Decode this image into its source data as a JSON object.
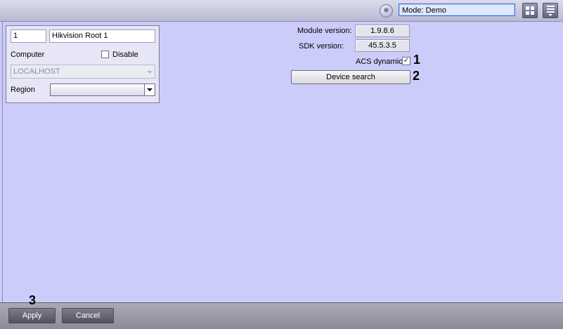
{
  "toolbar": {
    "mode_value": "Mode: Demo",
    "icons": [
      "star-icon",
      "grid-view-icon",
      "menu-icon"
    ]
  },
  "object_panel": {
    "id": "1",
    "name": "Hikvision Root 1",
    "computer_label": "Computer",
    "disable_label": "Disable",
    "disable_checked": false,
    "computer_value": "LOCALHOST",
    "region_label": "Region",
    "region_value": ""
  },
  "settings": {
    "module_version_label": "Module version:",
    "module_version_value": "1.9.8.6",
    "sdk_version_label": "SDK version:",
    "sdk_version_value": "45.5.3.5",
    "acs_dynamic_label": "ACS dynamic",
    "acs_dynamic_checked": true,
    "device_search_label": "Device search"
  },
  "callouts": [
    "1",
    "2",
    "3"
  ],
  "footer": {
    "apply_label": "Apply",
    "cancel_label": "Cancel"
  },
  "colors": {
    "content_bg": "#ccccfa",
    "mode_field_border": "#3a6ae0",
    "footer_button": "#6a6a78"
  }
}
